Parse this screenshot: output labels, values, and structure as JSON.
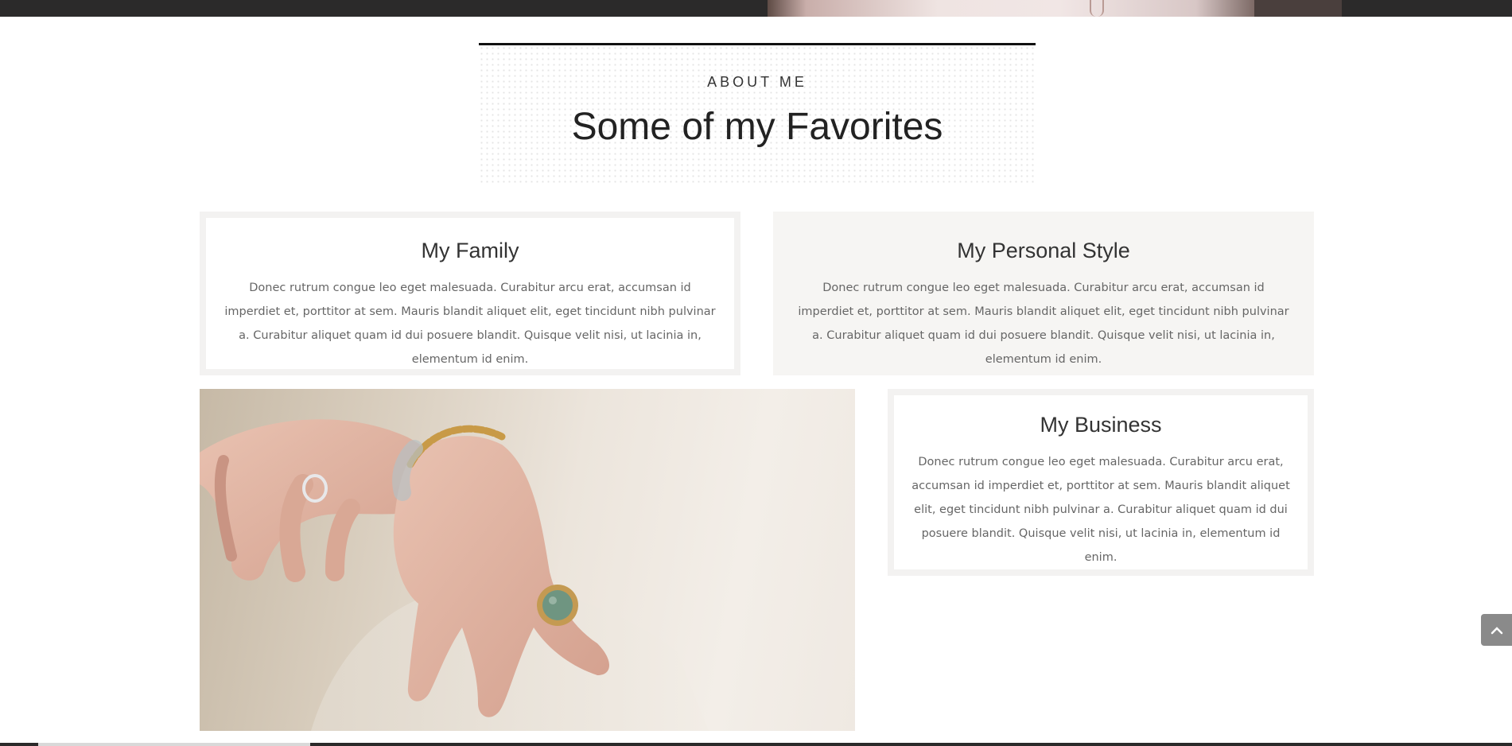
{
  "header": {
    "eyebrow": "ABOUT ME",
    "title": "Some of my Favorites"
  },
  "cards": {
    "family": {
      "title": "My Family",
      "text": "Donec rutrum congue leo eget malesuada. Curabitur arcu erat, accumsan id imperdiet et, porttitor at sem. Mauris blandit aliquet elit, eget tincidunt nibh pulvinar a. Curabitur aliquet quam id dui posuere blandit. Quisque velit nisi, ut lacinia in, elementum id enim."
    },
    "personal_style": {
      "title": "My Personal Style",
      "text": "Donec rutrum congue leo eget malesuada. Curabitur arcu erat, accumsan id imperdiet et, porttitor at sem. Mauris blandit aliquet elit, eget tincidunt nibh pulvinar a. Curabitur aliquet quam id dui posuere blandit. Quisque velit nisi, ut lacinia in, elementum id enim."
    },
    "business": {
      "title": "My Business",
      "text": "Donec rutrum congue leo eget malesuada. Curabitur arcu erat, accumsan id imperdiet et, porttitor at sem. Mauris blandit aliquet elit, eget tincidunt nibh pulvinar a. Curabitur aliquet quam id dui posuere blandit. Quisque velit nisi, ut lacinia in, elementum id enim."
    }
  },
  "icons": {
    "scroll_top": "chevron-up-icon"
  },
  "colors": {
    "banner": "#2b2a2a",
    "card_filled": "#f6f5f3",
    "card_border": "#f3f2f1",
    "scroll_button": "#8a8a8a"
  }
}
